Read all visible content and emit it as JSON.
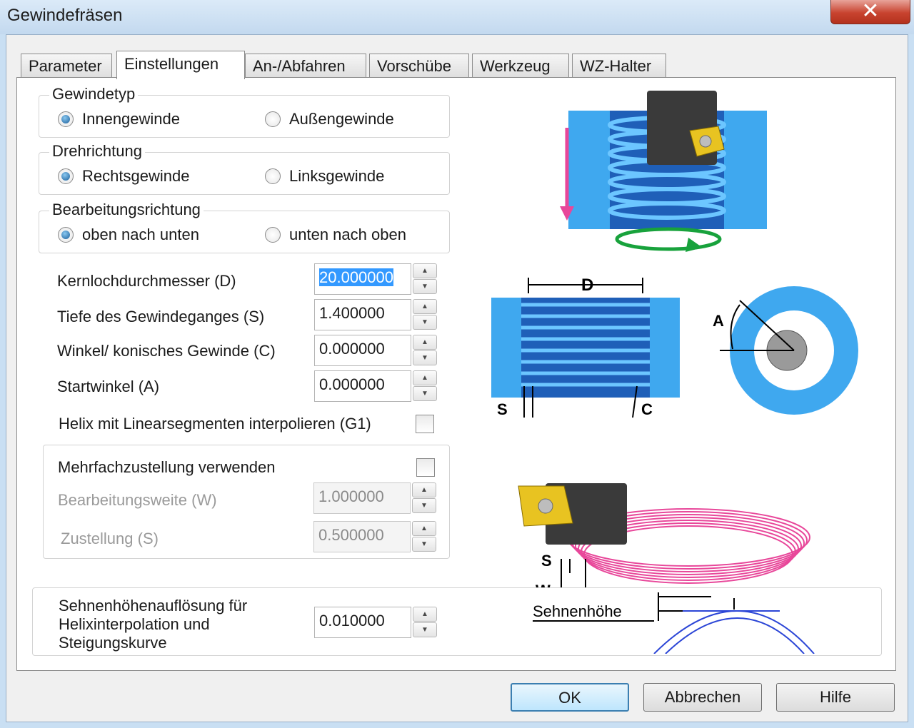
{
  "window": {
    "title": "Gewindefräsen",
    "close_glyph": "✕"
  },
  "tabs": [
    {
      "label": "Parameter"
    },
    {
      "label": "Einstellungen",
      "active": true
    },
    {
      "label": "An-/Abfahren"
    },
    {
      "label": "Vorschübe"
    },
    {
      "label": "Werkzeug"
    },
    {
      "label": "WZ-Halter"
    }
  ],
  "gewindetyp": {
    "title": "Gewindetyp",
    "option1": "Innengewinde",
    "option2": "Außengewinde",
    "selected": "Innengewinde"
  },
  "drehrichtung": {
    "title": "Drehrichtung",
    "option1": "Rechtsgewinde",
    "option2": "Linksgewinde",
    "selected": "Rechtsgewinde"
  },
  "bearbeitungsrichtung": {
    "title": "Bearbeitungsrichtung",
    "option1": "oben nach unten",
    "option2": "unten nach oben",
    "selected": "oben nach unten"
  },
  "fields": {
    "kernloch": {
      "label": "Kernlochdurchmesser (D)",
      "value": "20.000000"
    },
    "tiefe": {
      "label": "Tiefe des Gewindeganges (S)",
      "value": "1.400000"
    },
    "winkel": {
      "label": "Winkel/ konisches Gewinde (C)",
      "value": "0.000000"
    },
    "startwinkel": {
      "label": "Startwinkel (A)",
      "value": "0.000000"
    }
  },
  "helix": {
    "label": "Helix mit Linearsegmenten interpolieren (G1)",
    "checked": false
  },
  "mehrfach": {
    "label": "Mehrfachzustellung verwenden",
    "checked": false,
    "bearbeitungsweite": {
      "label": "Bearbeitungsweite (W)",
      "value": "1.000000"
    },
    "zustellung": {
      "label": "Zustellung (S)",
      "value": "0.500000"
    }
  },
  "sehnen": {
    "label_line1": "Sehnenhöhenauflösung für",
    "label_line2": "Helixinterpolation und",
    "label_line3": "Steigungskurve",
    "value": "0.010000",
    "diagram_label": "Sehnenhöhe"
  },
  "diagram_labels": {
    "D": "D",
    "S": "S",
    "C": "C",
    "A": "A",
    "W": "W"
  },
  "colors": {
    "thread_blue": "#2f7fd6",
    "material_blue": "#3fa8ef",
    "pink": "#e8479a",
    "green": "#18a23c"
  },
  "buttons": {
    "ok": "OK",
    "cancel": "Abbrechen",
    "help": "Hilfe"
  }
}
